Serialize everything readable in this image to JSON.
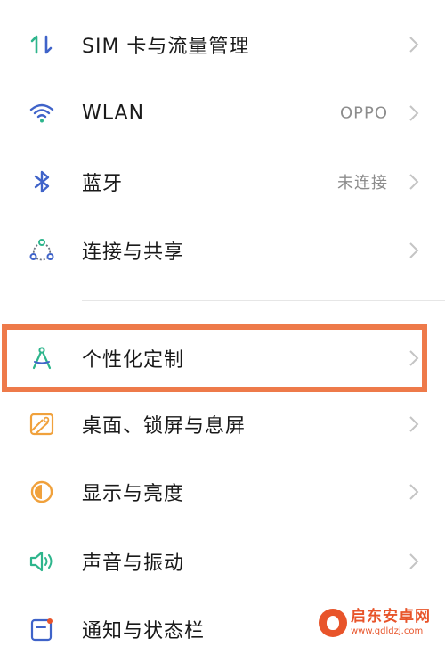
{
  "settings": {
    "items": [
      {
        "label": "SIM 卡与流量管理",
        "value": "",
        "icon": "sim-data-icon"
      },
      {
        "label": "WLAN",
        "value": "OPPO",
        "icon": "wifi-icon"
      },
      {
        "label": "蓝牙",
        "value": "未连接",
        "icon": "bluetooth-icon"
      },
      {
        "label": "连接与共享",
        "value": "",
        "icon": "connection-sharing-icon"
      },
      {
        "label": "个性化定制",
        "value": "",
        "icon": "personalization-icon"
      },
      {
        "label": "桌面、锁屏与息屏",
        "value": "",
        "icon": "wallpaper-icon"
      },
      {
        "label": "显示与亮度",
        "value": "",
        "icon": "display-brightness-icon"
      },
      {
        "label": "声音与振动",
        "value": "",
        "icon": "sound-icon"
      },
      {
        "label": "通知与状态栏",
        "value": "",
        "icon": "notification-icon"
      }
    ]
  },
  "highlight": {
    "target": "个性化定制",
    "color": "#ee7a4a"
  },
  "watermark": {
    "name": "启东安卓网",
    "url": "www.qdldzj.com"
  },
  "colors": {
    "accent_green": "#2db58c",
    "accent_blue": "#3f63c9",
    "accent_orange": "#f0a13c",
    "chevron": "#c4c4c4"
  }
}
